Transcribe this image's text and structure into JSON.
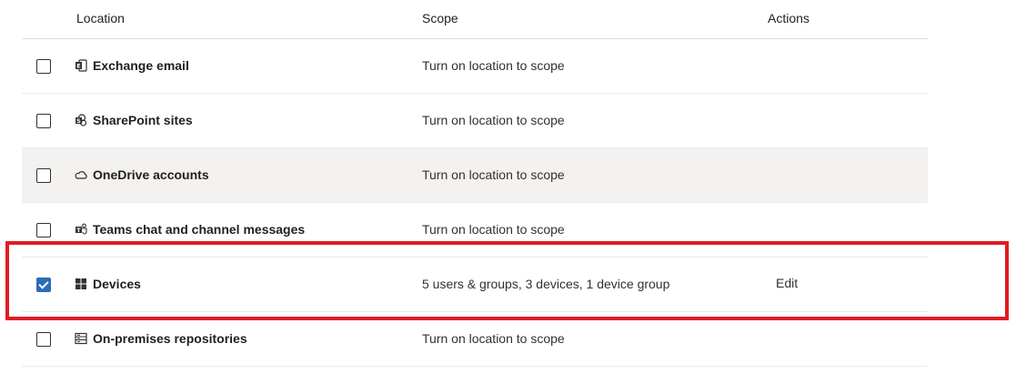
{
  "columns": {
    "location": "Location",
    "scope": "Scope",
    "actions": "Actions"
  },
  "rows": [
    {
      "checked": false,
      "icon": "exchange-icon",
      "name": "Exchange email",
      "scope": "Turn on location to scope",
      "action": ""
    },
    {
      "checked": false,
      "icon": "sharepoint-icon",
      "name": "SharePoint sites",
      "scope": "Turn on location to scope",
      "action": ""
    },
    {
      "checked": false,
      "icon": "onedrive-icon",
      "name": "OneDrive accounts",
      "scope": "Turn on location to scope",
      "action": ""
    },
    {
      "checked": false,
      "icon": "teams-icon",
      "name": "Teams chat and channel messages",
      "scope": "Turn on location to scope",
      "action": ""
    },
    {
      "checked": true,
      "icon": "windows-icon",
      "name": "Devices",
      "scope": "5 users & groups, 3 devices, 1 device group",
      "action": "Edit"
    },
    {
      "checked": false,
      "icon": "server-icon",
      "name": "On-premises repositories",
      "scope": "Turn on location to scope",
      "action": ""
    }
  ],
  "colors": {
    "checkbox_checked": "#2b6bb8",
    "highlight_border": "#e21b23",
    "hover_row": "#f3f2f1"
  }
}
